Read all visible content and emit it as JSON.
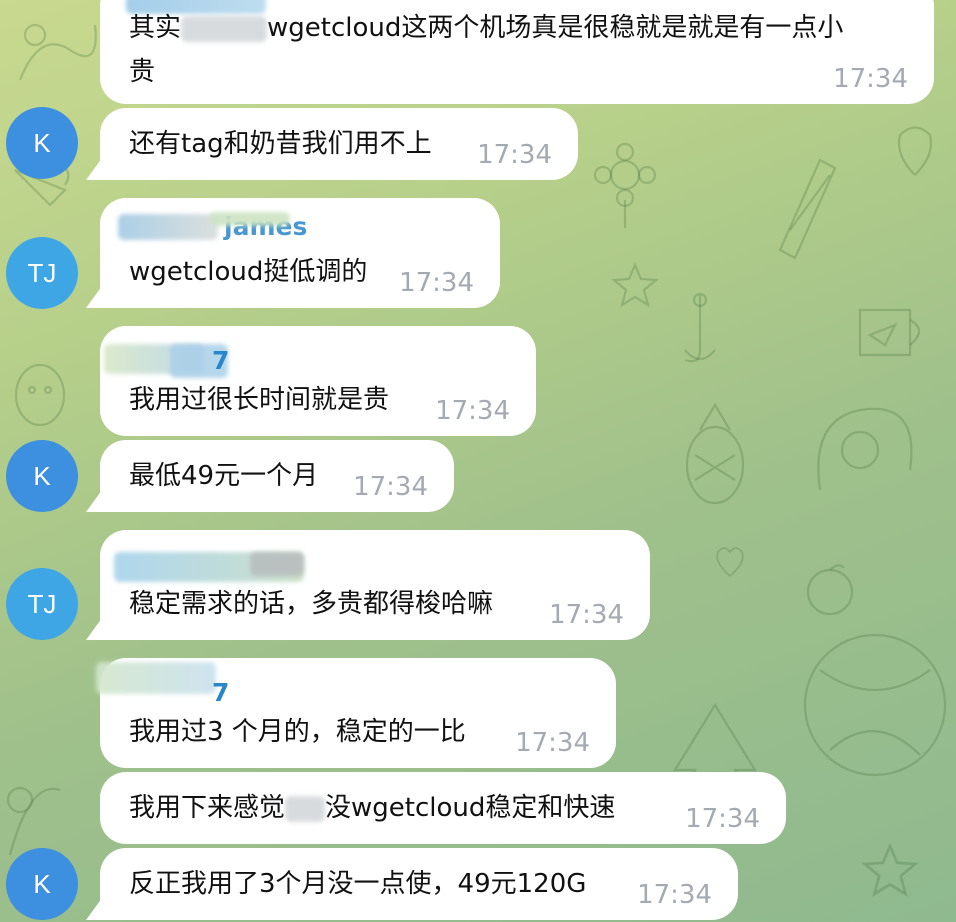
{
  "colors": {
    "accent": "#2a86c8",
    "avatar_k": "#3d8fe0",
    "avatar_tj": "#3fa6e6",
    "bubble": "#ffffff",
    "time": "#a4aab2"
  },
  "messages": [
    {
      "text_lines": [
        "其实",
        "wgetcloud这两个机场真是很稳就是就是有一点小",
        "贵"
      ],
      "time": "17:34"
    },
    {
      "avatar": "K",
      "text": "还有tag和奶昔我们用不上",
      "time": "17:34"
    },
    {
      "avatar": "TJ",
      "sender": "james",
      "text": "wgetcloud挺低调的",
      "time": "17:34"
    },
    {
      "sender": "7",
      "text": "我用过很长时间就是贵",
      "time": "17:34"
    },
    {
      "avatar": "K",
      "text": "最低49元一个月",
      "time": "17:34"
    },
    {
      "avatar": "TJ",
      "text": "稳定需求的话，多贵都得梭哈嘛",
      "time": "17:34"
    },
    {
      "sender": "7",
      "text": "我用过3 个月的，稳定的一比",
      "time": "17:34"
    },
    {
      "text_lines": [
        "我用下来感觉",
        "没wgetcloud稳定和快速"
      ],
      "time": "17:34"
    },
    {
      "avatar": "K",
      "text": "反正我用了3个月没一点使，49元120G",
      "time": "17:34"
    }
  ]
}
